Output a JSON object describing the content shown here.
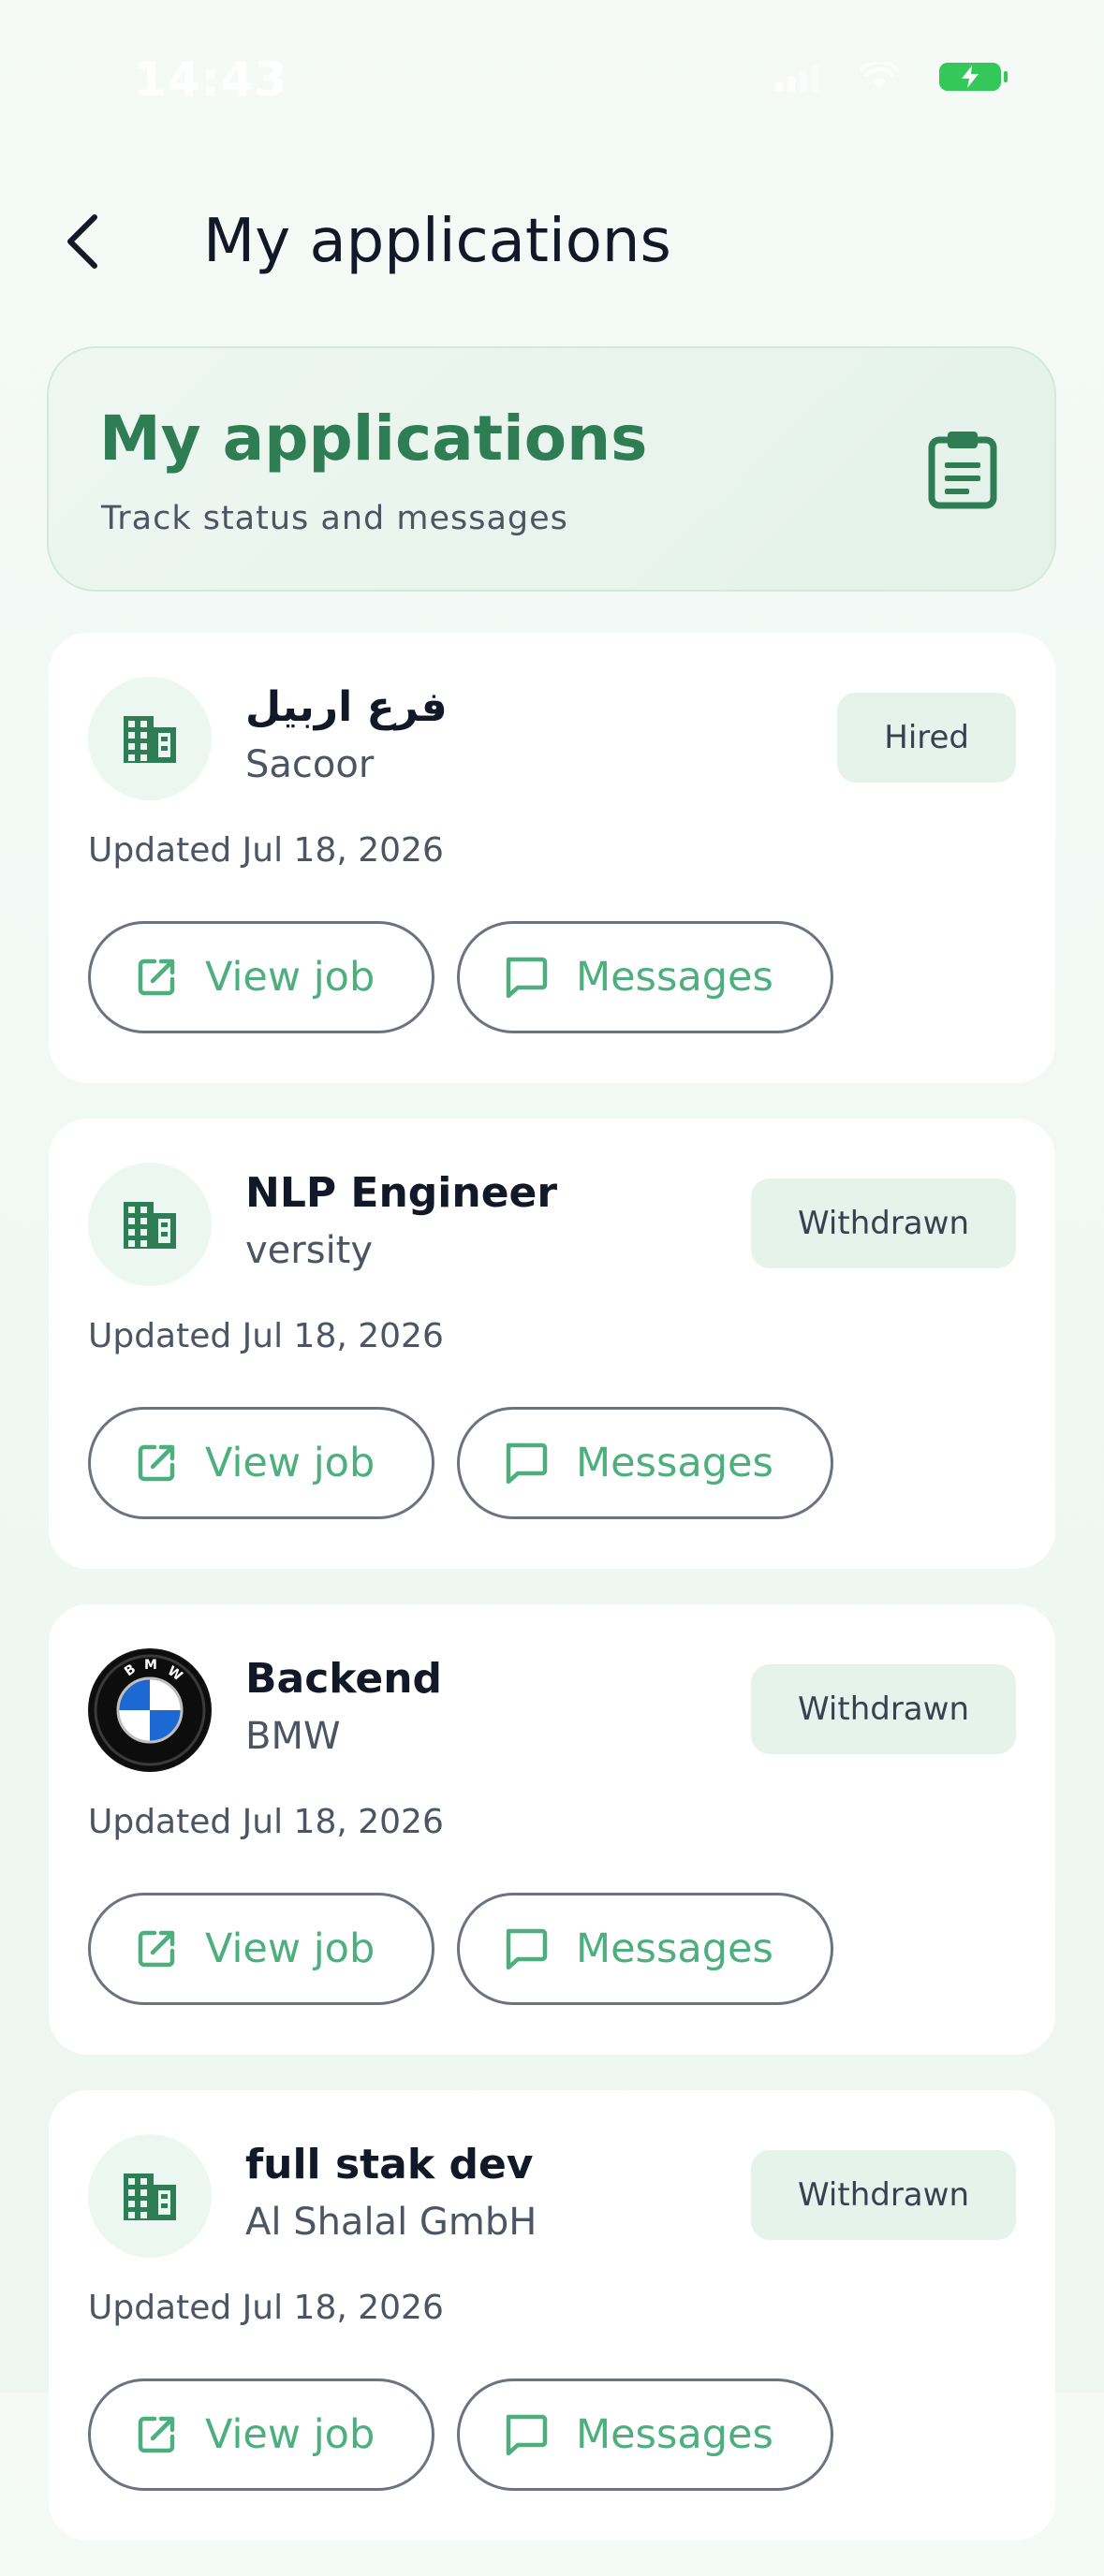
{
  "status_bar": {
    "time": "14:43"
  },
  "header": {
    "title": "My applications"
  },
  "hero": {
    "title": "My applications",
    "subtitle": "Track status and messages",
    "icon": "clipboard-icon"
  },
  "applications": [
    {
      "title": "فرع اربيل",
      "company": "Sacoor",
      "status": "Hired",
      "updated": "Updated Jul 18, 2026",
      "logo": "building-icon",
      "view_label": "View job",
      "messages_label": "Messages"
    },
    {
      "title": "NLP Engineer",
      "company": "versity",
      "status": "Withdrawn",
      "updated": "Updated Jul 18, 2026",
      "logo": "building-icon",
      "view_label": "View job",
      "messages_label": "Messages"
    },
    {
      "title": "Backend",
      "company": "BMW",
      "status": "Withdrawn",
      "updated": "Updated Jul 18, 2026",
      "logo": "bmw-logo",
      "view_label": "View job",
      "messages_label": "Messages"
    },
    {
      "title": "full stak dev",
      "company": "Al Shalal GmbH",
      "status": "Withdrawn",
      "updated": "Updated Jul 18, 2026",
      "logo": "building-icon",
      "view_label": "View job",
      "messages_label": "Messages"
    }
  ],
  "colors": {
    "accent": "#2e7d55",
    "accent_light": "#4caf7d",
    "badge_bg": "#e6f3ea"
  }
}
